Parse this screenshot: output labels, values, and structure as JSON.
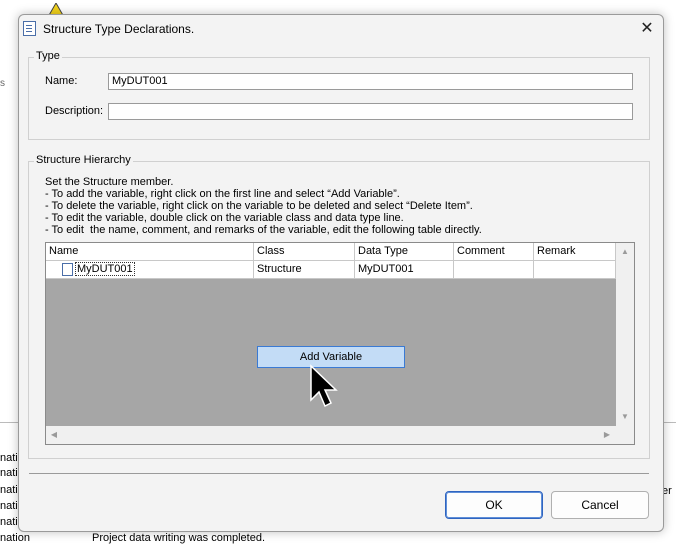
{
  "background": {
    "status_line": "Project data writing was completed.",
    "left_fragments": [
      "nati",
      "nati",
      "nati",
      "nati",
      "nati",
      "nation"
    ],
    "right_fragment": "er",
    "left_edge_mark": "s"
  },
  "dialog": {
    "title": "Structure Type Declarations.",
    "close_glyph": "✕",
    "type_group": {
      "label": "Type",
      "name_label": "Name:",
      "name_value": "MyDUT001",
      "description_label": "Description:",
      "description_value": ""
    },
    "hierarchy_group": {
      "label": "Structure Hierarchy",
      "instructions": [
        "Set the Structure member.",
        "- To add the variable, right click on the first line and select “Add Variable”.",
        "- To delete the variable, right click on the variable to be deleted and select “Delete Item”.",
        "- To edit the variable, double click on the variable class and data type line.",
        "- To edit  the name, comment, and remarks of the variable, edit the following table directly."
      ]
    },
    "grid": {
      "columns": [
        "Name",
        "Class",
        "Data Type",
        "Comment",
        "Remark"
      ],
      "rows": [
        {
          "name": "MyDUT001",
          "class": "Structure",
          "data_type": "MyDUT001",
          "comment": "",
          "remark": ""
        }
      ]
    },
    "context_menu": {
      "items": [
        "Add Variable"
      ]
    },
    "buttons": {
      "ok": "OK",
      "cancel": "Cancel"
    }
  }
}
